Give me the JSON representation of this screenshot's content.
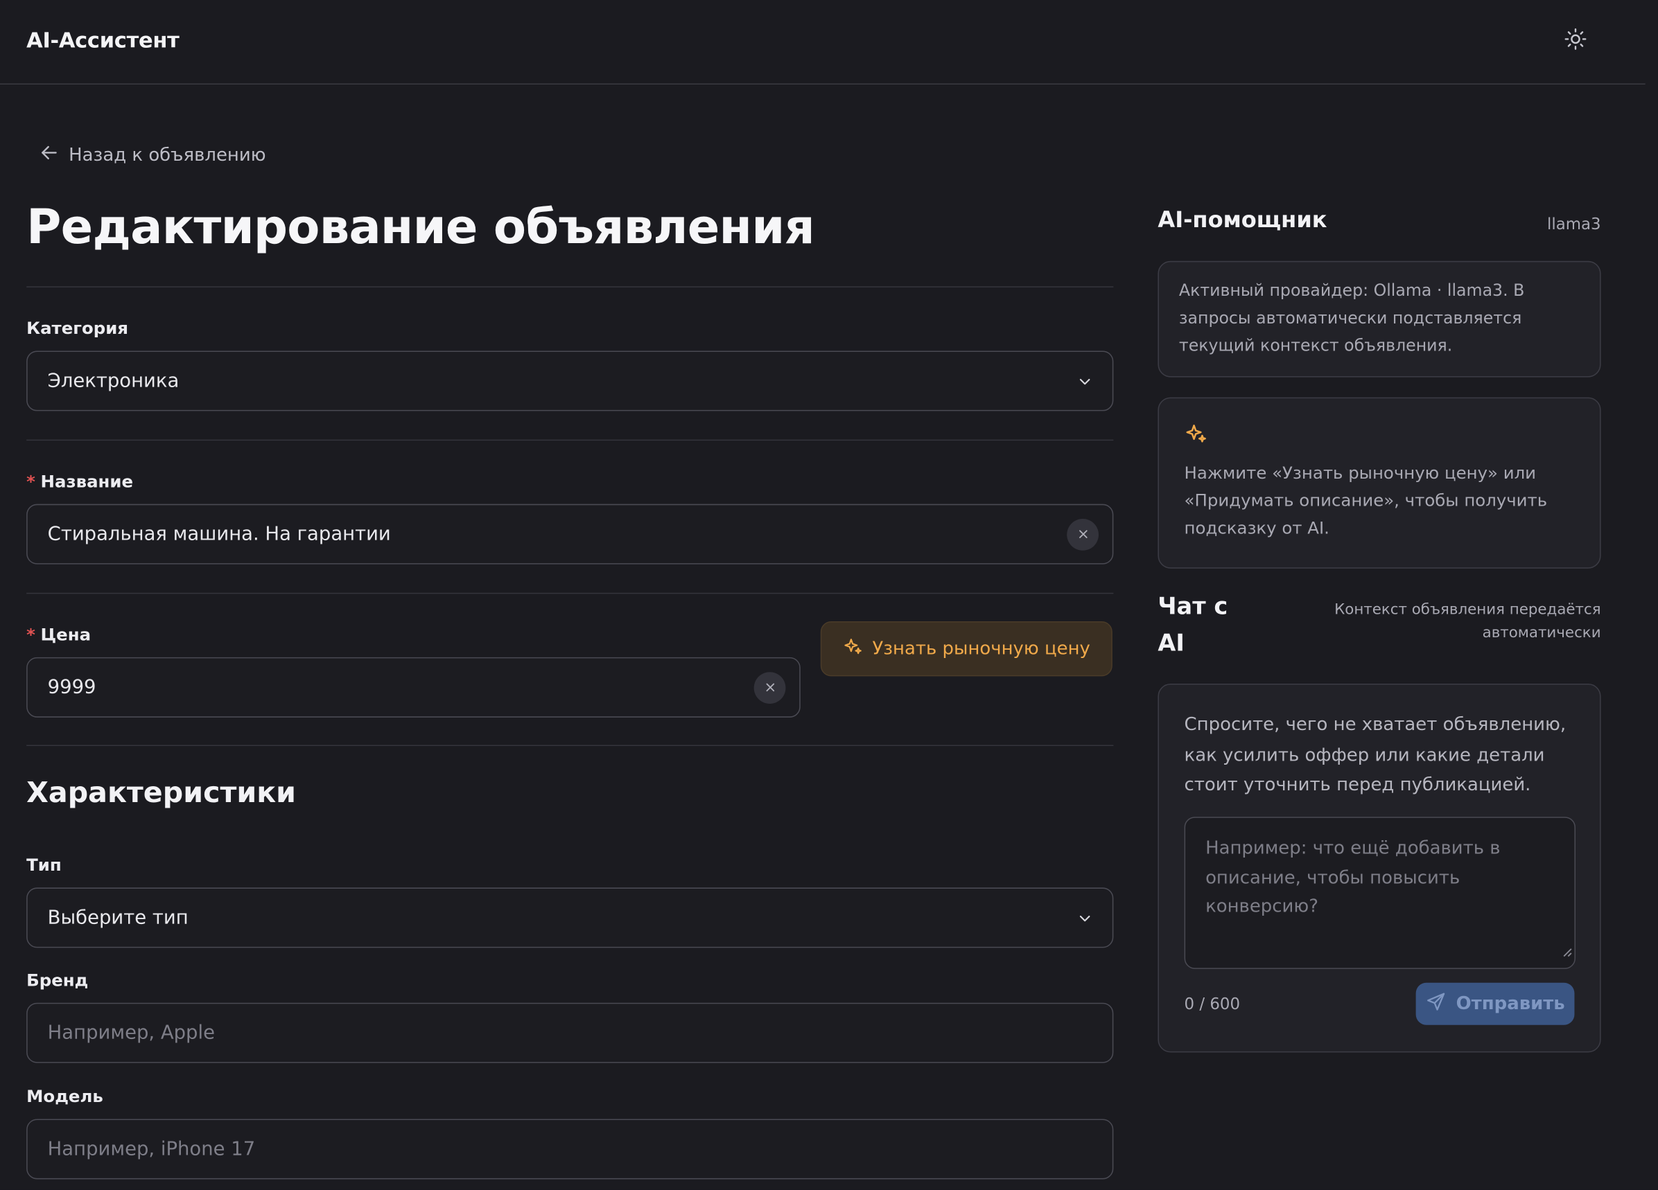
{
  "header": {
    "brand": "AI-Ассистент",
    "theme_icon": "sun-icon"
  },
  "nav": {
    "back_label": "Назад к объявлению"
  },
  "page": {
    "title": "Редактирование объявления"
  },
  "form": {
    "category": {
      "label": "Категория",
      "value": "Электроника"
    },
    "title": {
      "label": "Название",
      "required_mark": "*",
      "value": "Стиральная машина. На гарантии"
    },
    "price": {
      "label": "Цена",
      "required_mark": "*",
      "value": "9999"
    },
    "market_button": "Узнать рыночную цену",
    "specs_title": "Характеристики",
    "type": {
      "label": "Тип",
      "value": "Выберите тип"
    },
    "brand": {
      "label": "Бренд",
      "placeholder": "Например, Apple"
    },
    "model": {
      "label": "Модель",
      "placeholder": "Например, iPhone 17"
    }
  },
  "assistant": {
    "title": "AI-помощник",
    "model": "llama3",
    "provider_info": "Активный провайдер: Ollama · llama3. В запросы автоматически подставляется текущий контекст объявления.",
    "hint": "Нажмите «Узнать рыночную цену» или «Придумать описание», чтобы получить подсказку от AI."
  },
  "chat": {
    "title": "Чат с AI",
    "note": "Контекст объявления передаётся автоматически",
    "intro": "Спросите, чего не хватает объявлению, как усилить оффер или какие детали стоит уточнить перед публикацией.",
    "placeholder": "Например: что ещё добавить в описание, чтобы повысить конверсию?",
    "counter": "0 / 600",
    "send_label": "Отправить"
  },
  "colors": {
    "background": "#1b1b20",
    "accent_orange": "#f0a94a",
    "send_button": "#3a5583",
    "required": "#e05252"
  }
}
